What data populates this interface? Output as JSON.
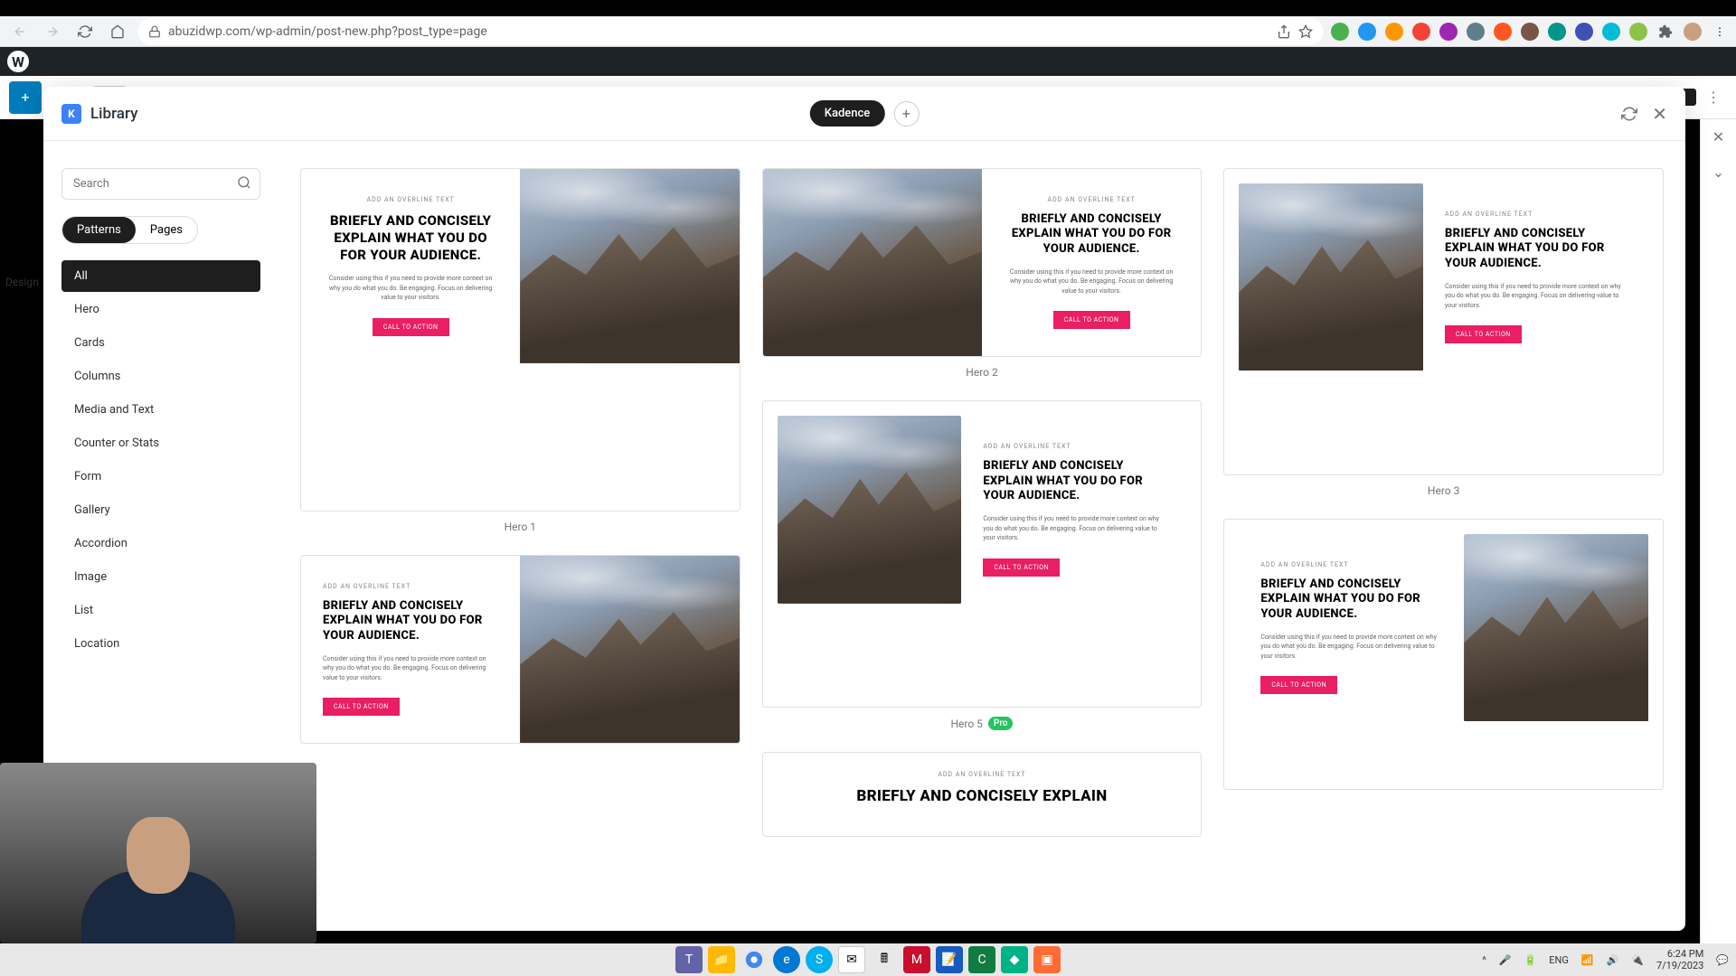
{
  "browser": {
    "url": "abuzidwp.com/wp-admin/post-new.php?post_type=page"
  },
  "library": {
    "title": "Library",
    "tab_active": "Kadence",
    "search_placeholder": "Search",
    "filter_patterns": "Patterns",
    "filter_pages": "Pages",
    "categories": [
      "All",
      "Hero",
      "Cards",
      "Columns",
      "Media and Text",
      "Counter or Stats",
      "Form",
      "Gallery",
      "Accordion",
      "Image",
      "List",
      "Location"
    ]
  },
  "side_panel": {
    "label": "Design"
  },
  "hero": {
    "overline": "ADD AN OVERLINE TEXT",
    "heading": "BRIEFLY AND CONCISELY EXPLAIN WHAT YOU DO FOR YOUR AUDIENCE.",
    "desc": "Consider using this if you need to provide more context on why you do what you do. Be engaging. Focus on delivering value to your visitors.",
    "cta": "CALL TO ACTION"
  },
  "patterns": {
    "p1": "Hero 1",
    "p2": "Hero 2",
    "p3": "Hero 3",
    "p5": "Hero 5",
    "pro": "Pro"
  },
  "hero6_heading": "BRIEFLY AND CONCISELY EXPLAIN",
  "taskbar": {
    "lang": "ENG",
    "time": "6:24 PM",
    "date": "7/19/2023"
  }
}
